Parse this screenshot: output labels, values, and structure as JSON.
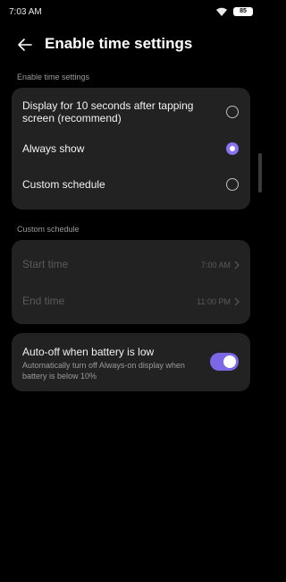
{
  "status_bar": {
    "time": "7:03 AM",
    "battery": "85",
    "wifi_icon": "wifi-icon"
  },
  "header": {
    "title": "Enable time settings",
    "back_icon": "back-arrow-icon"
  },
  "section_enable": {
    "label": "Enable time settings",
    "options": [
      {
        "label": "Display for 10 seconds after tapping screen (recommend)",
        "selected": false
      },
      {
        "label": "Always show",
        "selected": true
      },
      {
        "label": "Custom schedule",
        "selected": false
      }
    ]
  },
  "section_schedule": {
    "label": "Custom schedule",
    "start_label": "Start time",
    "start_value": "7:00 AM",
    "end_label": "End time",
    "end_value": "11:00 PM"
  },
  "battery_setting": {
    "title": "Auto-off when battery is low",
    "description": "Automatically turn off Always-on display when battery is below 10%",
    "enabled": true
  },
  "colors": {
    "accent": "#8a72f2",
    "card": "#222222",
    "background": "#000000"
  }
}
